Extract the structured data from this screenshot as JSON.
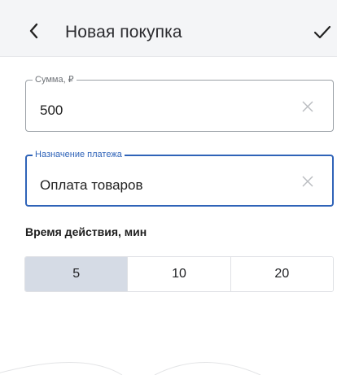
{
  "header": {
    "title": "Новая покупка"
  },
  "fields": {
    "amount": {
      "label": "Сумма, ₽",
      "value": "500"
    },
    "purpose": {
      "label": "Назначение платежа",
      "value": "Оплата товаров"
    }
  },
  "validity": {
    "title": "Время действия, мин",
    "options": [
      "5",
      "10",
      "20"
    ],
    "selected": "5"
  },
  "icons": {
    "back": "chevron-left-icon",
    "confirm": "checkmark-icon",
    "clear": "close-icon"
  },
  "colors": {
    "accent": "#2f63b8",
    "header_bg": "#f4f5f7",
    "selected_segment": "#d5dbe5"
  }
}
